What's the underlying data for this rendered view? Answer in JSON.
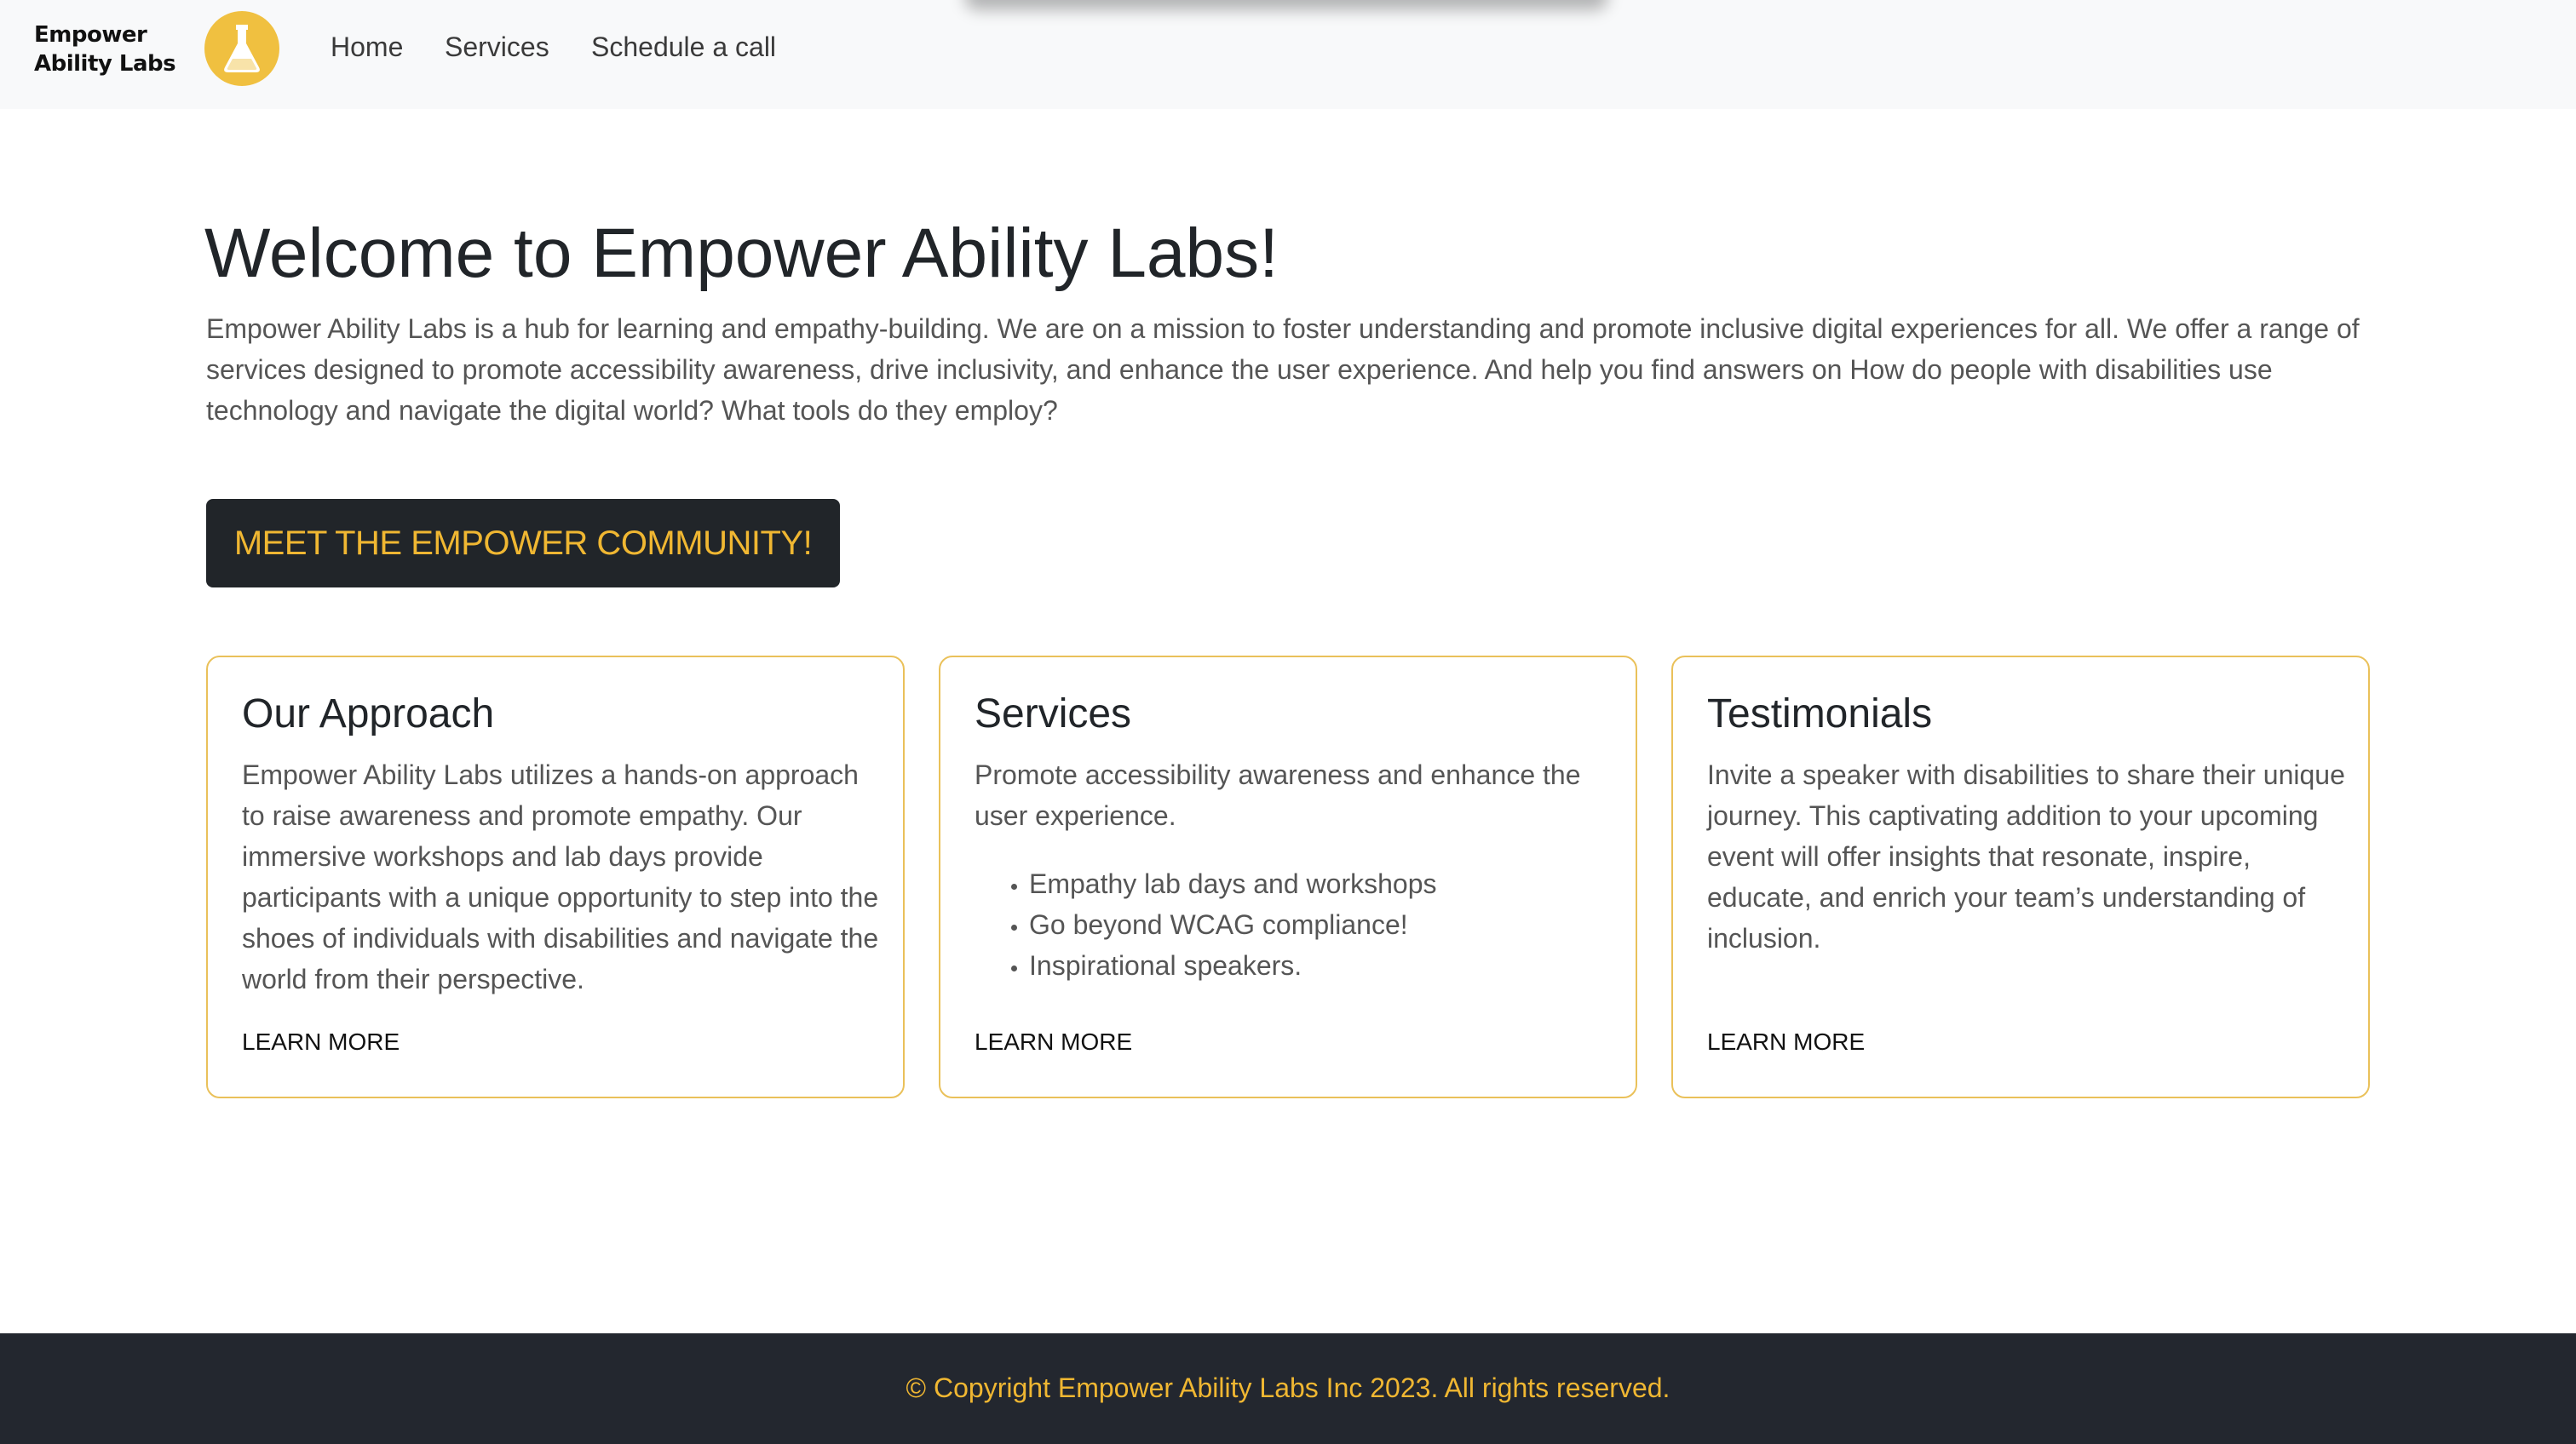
{
  "navbar": {
    "brand": "Empower Ability Labs",
    "links": [
      "Home",
      "Services",
      "Schedule a call"
    ]
  },
  "hero": {
    "title": "Welcome to Empower Ability Labs!",
    "text": "Empower Ability Labs is a hub for learning and empathy-building. We are on a mission to foster understanding and promote inclusive digital experiences for all. We offer a range of services designed to promote accessibility awareness, drive inclusivity, and enhance the user experience. And help you find answers on How do people with disabilities use technology and navigate the digital world? What tools do they employ?",
    "cta_label": "MEET THE EMPOWER COMMUNITY!"
  },
  "cards": [
    {
      "title": "Our Approach",
      "text": "Empower Ability Labs utilizes a hands-on approach to raise awareness and promote empathy. Our immersive workshops and lab days provide participants with a unique opportunity to step into the shoes of individuals with disabilities and navigate the world from their perspective.",
      "link": "LEARN MORE"
    },
    {
      "title": "Services",
      "text": "Promote accessibility awareness and enhance the user experience.",
      "items": [
        "Empathy lab days and workshops",
        "Go beyond WCAG compliance!",
        "Inspirational speakers."
      ],
      "link": "LEARN MORE"
    },
    {
      "title": "Testimonials",
      "text": "Invite a speaker with disabilities to share their unique journey. This captivating addition to your upcoming event will offer insights that resonate, inspire, educate, and enrich your team’s understanding of inclusion.",
      "link": "LEARN MORE"
    }
  ],
  "footer": {
    "text": "© Copyright Empower Ability Labs Inc 2023. All rights reserved."
  },
  "icons": {
    "logo": "flask-icon"
  },
  "colors": {
    "accent": "#f0b732",
    "card_border": "#eac15a",
    "dark": "#212529",
    "footer_bg": "#23272f",
    "navbar_bg": "#f8f9fa"
  }
}
